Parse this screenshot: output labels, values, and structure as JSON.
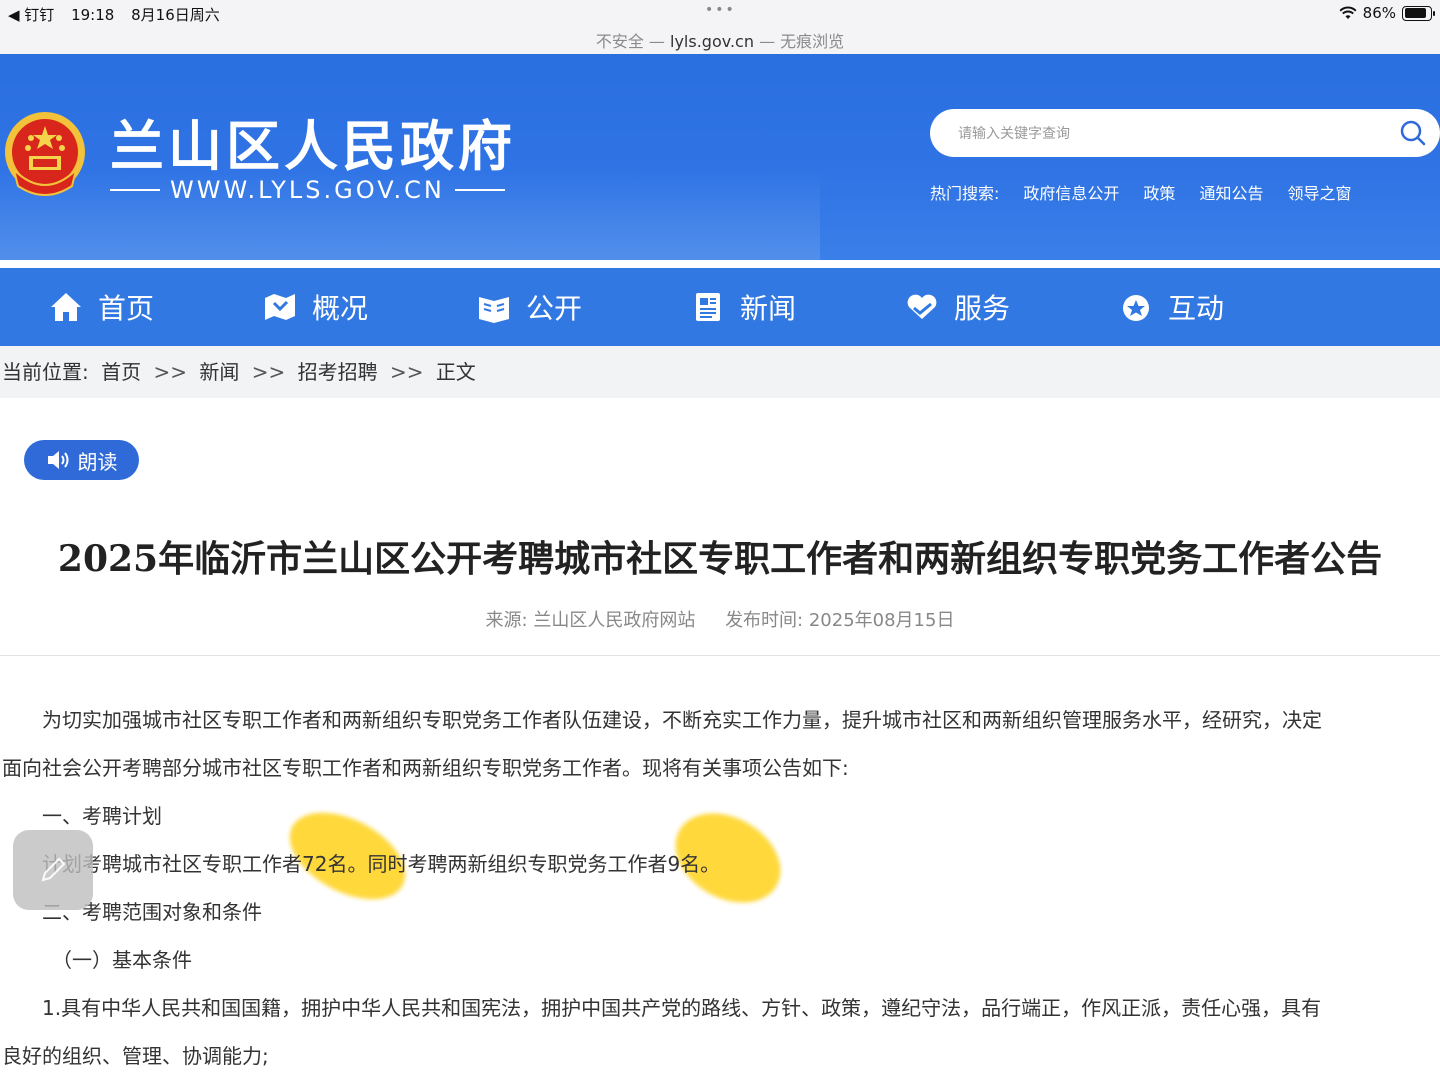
{
  "status_bar": {
    "back_app": "◀ 钉钉",
    "time": "19:18",
    "date": "8月16日周六",
    "dots": "•••",
    "url_prefix": "不安全 — ",
    "url_host": "lyls.gov.cn",
    "url_suffix": " — 无痕浏览",
    "battery": "86%",
    "battery_level": 0.86
  },
  "site": {
    "title": "兰山区人民政府",
    "url_text": "WWW.LYLS.GOV.CN",
    "search_placeholder": "请输入关键字查询",
    "hot_label": "热门搜索:",
    "hot_items": [
      "政府信息公开",
      "政策",
      "通知公告",
      "领导之窗"
    ]
  },
  "nav": [
    {
      "label": "首页",
      "icon": "home-icon"
    },
    {
      "label": "概况",
      "icon": "map-icon"
    },
    {
      "label": "公开",
      "icon": "book-icon"
    },
    {
      "label": "新闻",
      "icon": "news-icon"
    },
    {
      "label": "服务",
      "icon": "heart-hands-icon"
    },
    {
      "label": "互动",
      "icon": "chat-icon"
    }
  ],
  "breadcrumb": {
    "label": "当前位置:",
    "items": [
      "首页",
      "新闻",
      "招考招聘",
      "正文"
    ],
    "separator": ">>"
  },
  "read_button": "朗读",
  "article": {
    "title": "2025年临沂市兰山区公开考聘城市社区专职工作者和两新组织专职党务工作者公告",
    "source": "来源: 兰山区人民政府网站",
    "date": "发布时间: 2025年08月15日",
    "paragraphs": [
      "为切实加强城市社区专职工作者和两新组织专职党务工作者队伍建设，不断充实工作力量，提升城市社区和两新组织管理服务水平，经研究，决定",
      "面向社会公开考聘部分城市社区专职工作者和两新组织专职党务工作者。现将有关事项公告如下:",
      "一、考聘计划",
      "计划考聘城市社区专职工作者72名。同时考聘两新组织专职党务工作者9名。",
      "二、考聘范围对象和条件",
      "（一）基本条件",
      "1.具有中华人民共和国国籍，拥护中华人民共和国宪法，拥护中国共产党的路线、方针、政策，遵纪守法，品行端正，作风正派，责任心强，具有",
      "良好的组织、管理、协调能力;"
    ]
  },
  "colors": {
    "header_blue": "#2f73e5",
    "nav_blue": "#3178e2",
    "highlight": "#ffd21a"
  }
}
